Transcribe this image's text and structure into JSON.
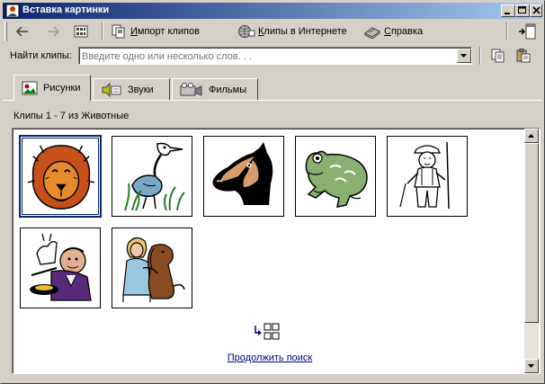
{
  "window": {
    "title": "Вставка картинки",
    "minimize_label": "_",
    "maximize_label": "□",
    "close_label": "×"
  },
  "toolbar": {
    "back_icon": "back-arrow-icon",
    "forward_icon": "forward-arrow-icon",
    "view_icon": "thumbnail-view-icon",
    "import_label": "Импорт клипов",
    "online_label": "Клипы в Интернете",
    "help_label": "Справка",
    "help_u": "С",
    "help_rest": "правка",
    "import_u": "И",
    "import_rest": "мпорт клипов",
    "online_u": "К",
    "online_rest": "липы в Интернете"
  },
  "search": {
    "label": "Найти клипы:",
    "placeholder": "Введите одно или несколько слов. . .",
    "value": ""
  },
  "tabs": [
    {
      "label": "Рисунки",
      "active": true
    },
    {
      "label": "Звуки",
      "active": false
    },
    {
      "label": "Фильмы",
      "active": false
    }
  ],
  "content": {
    "status": "Клипы 1 - 7 из Животные",
    "continue_search": "Продолжить поиск"
  },
  "clips": [
    {
      "name": "lion",
      "selected": true
    },
    {
      "name": "heron",
      "selected": false
    },
    {
      "name": "horse",
      "selected": false
    },
    {
      "name": "frog",
      "selected": false
    },
    {
      "name": "farmer",
      "selected": false
    },
    {
      "name": "magician",
      "selected": false
    },
    {
      "name": "girl-with-dog",
      "selected": false
    }
  ],
  "colors": {
    "title_bar_start": "#0a246a",
    "title_bar_end": "#a6caf0",
    "face": "#d4d0c8",
    "link": "#000080"
  }
}
